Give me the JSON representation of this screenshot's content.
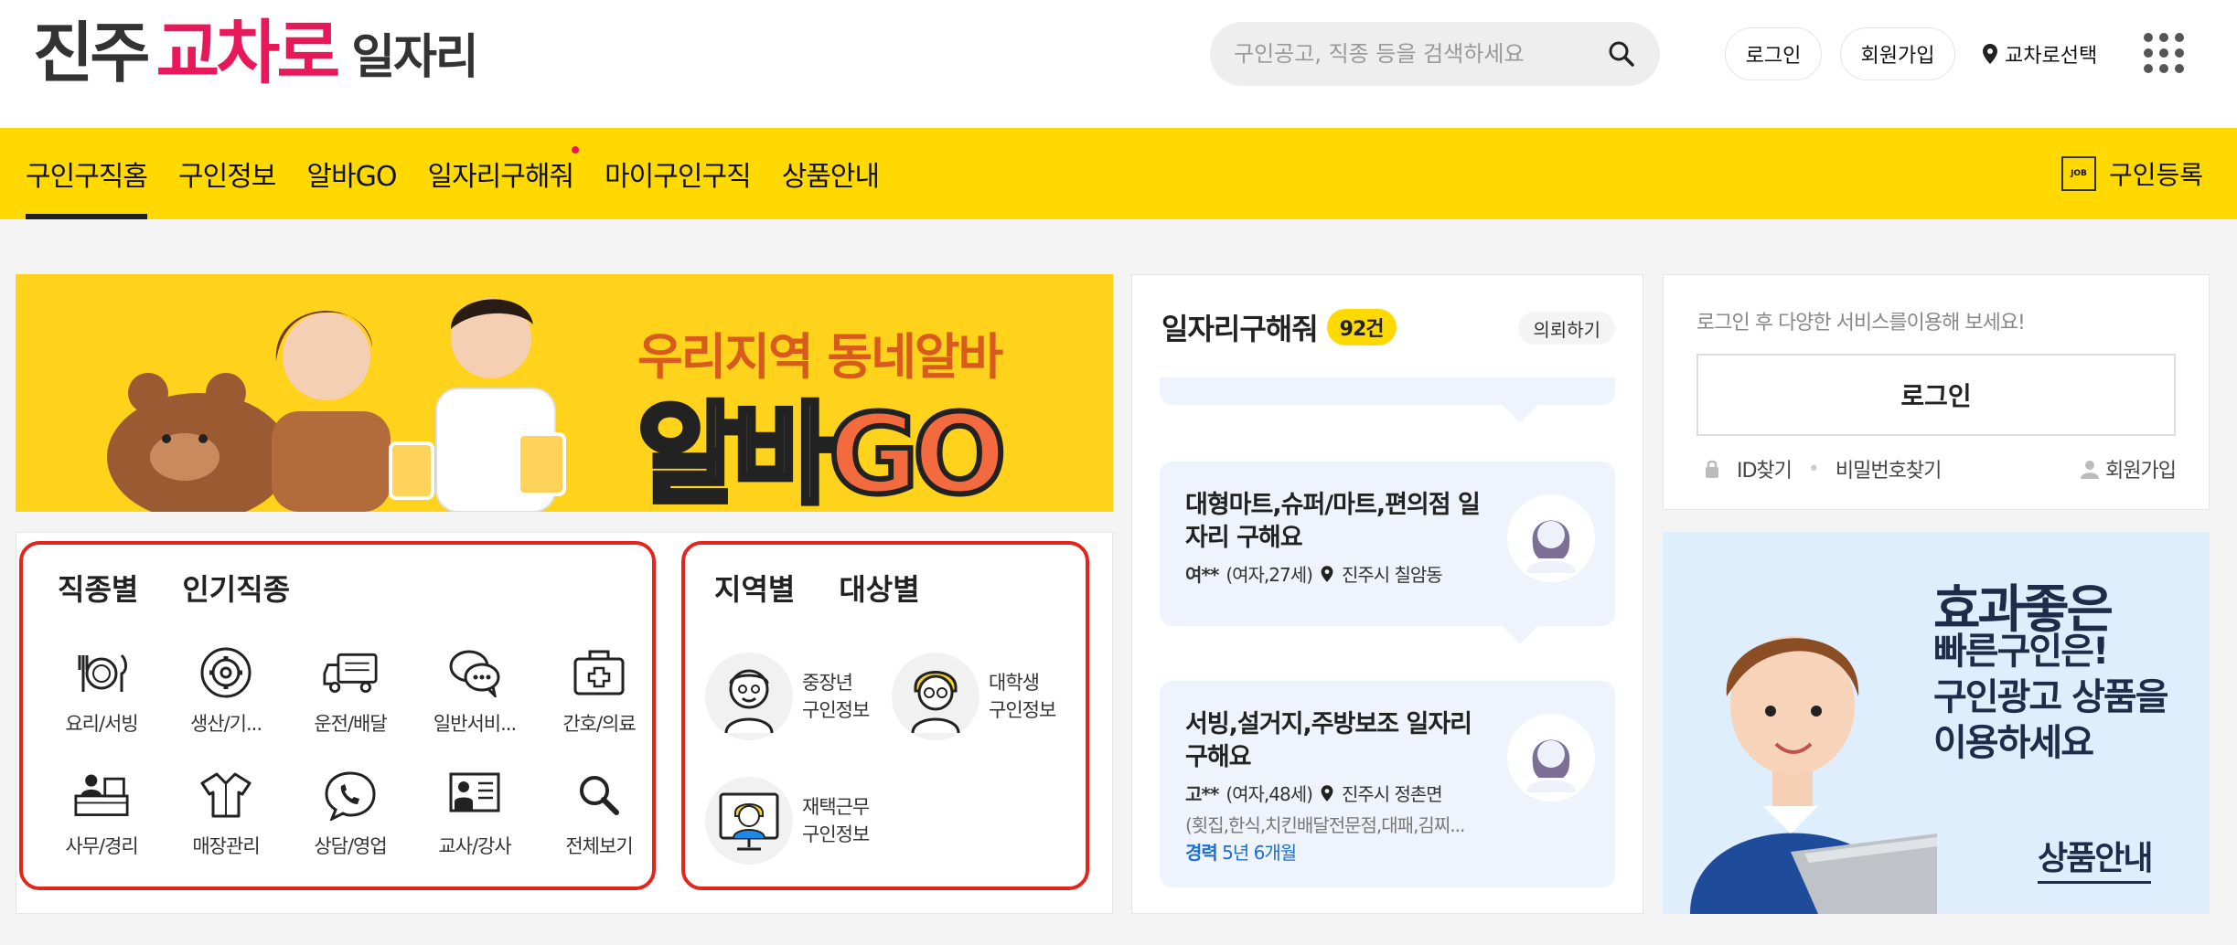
{
  "header": {
    "logo_part1": "진주",
    "logo_part2": "교차로",
    "logo_part3": "일자리",
    "search_placeholder": "구인공고, 직종 등을 검색하세요",
    "login_label": "로그인",
    "signup_label": "회원가입",
    "region_label": "교차로선택"
  },
  "nav": {
    "items": [
      {
        "label": "구인구직홈"
      },
      {
        "label": "구인정보"
      },
      {
        "label": "알바GO"
      },
      {
        "label": "일자리구해줘"
      },
      {
        "label": "마이구인구직"
      },
      {
        "label": "상품안내"
      }
    ],
    "register_label": "구인등록",
    "register_icon_text": "JOB",
    "accent_color": "#ffd900"
  },
  "banner": {
    "line1": "우리지역 동네알바",
    "line2a": "알바",
    "line2b": "GO"
  },
  "category": {
    "tab1": "직종별",
    "tab2": "인기직종",
    "jobs": [
      {
        "label": "요리/서빙",
        "icon": "dining-icon"
      },
      {
        "label": "생산/기...",
        "icon": "gear-icon"
      },
      {
        "label": "운전/배달",
        "icon": "truck-icon"
      },
      {
        "label": "일반서비...",
        "icon": "chat-bubble-icon"
      },
      {
        "label": "간호/의료",
        "icon": "medical-kit-icon"
      },
      {
        "label": "사무/경리",
        "icon": "office-desk-icon"
      },
      {
        "label": "매장관리",
        "icon": "shirt-icon"
      },
      {
        "label": "상담/영업",
        "icon": "phone-bubble-icon"
      },
      {
        "label": "교사/강사",
        "icon": "teacher-board-icon"
      },
      {
        "label": "전체보기",
        "icon": "search-icon"
      }
    ]
  },
  "target": {
    "tab1": "지역별",
    "tab2": "대상별",
    "items": [
      {
        "line1": "중장년",
        "line2": "구인정보"
      },
      {
        "line1": "대학생",
        "line2": "구인정보"
      },
      {
        "line1": "재택근무",
        "line2": "구인정보"
      }
    ]
  },
  "jobreq": {
    "title": "일자리구해줘",
    "count": "92건",
    "request_label": "의뢰하기",
    "cards": [
      {
        "title": "대형마트,슈퍼/마트,편의점 일자리 구해요",
        "name": "여**",
        "info": "(여자,27세)",
        "location": "진주시 칠암동"
      },
      {
        "title": "서빙,설거지,주방보조 일자리 구해요",
        "name": "고**",
        "info": "(여자,48세)",
        "location": "진주시 정촌면",
        "desc": "(횟집,한식,치킨배달전문점,대패,김찌...",
        "exp_label": "경력",
        "exp_value": "5년 6개월"
      }
    ]
  },
  "login": {
    "message": "로그인 후 다양한 서비스를이용해 보세요!",
    "button": "로그인",
    "find_id": "ID찾기",
    "find_pw": "비밀번호찾기",
    "join": "회원가입"
  },
  "ad": {
    "headline": "효과좋은",
    "body": "빠른구인은!\n구인광고 상품을\n이용하세요",
    "cta": "상품안내"
  }
}
